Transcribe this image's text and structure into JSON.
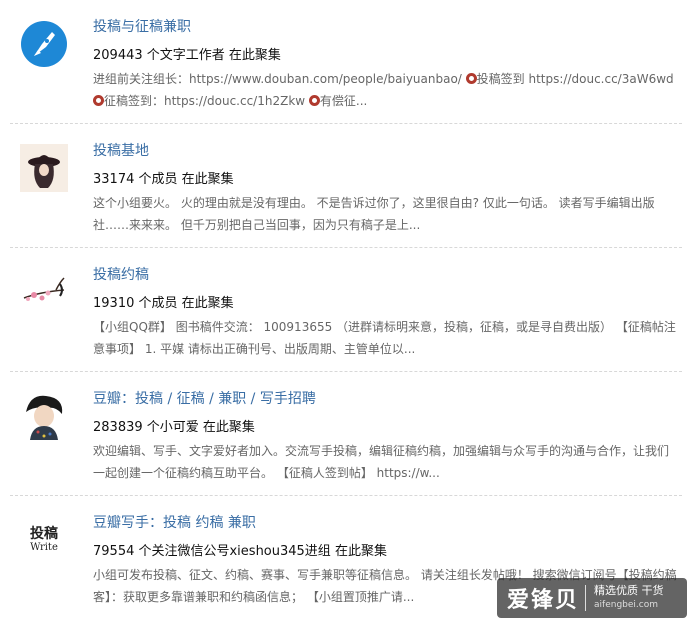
{
  "groups": [
    {
      "title": "投稿与征稿兼职",
      "meta": "209443 个文字工作者 在此聚集",
      "desc_line1_a": "进组前关注组长：https://www.douban.com/people/baiyuanbao/ ",
      "desc_line1_b": "投稿签到 https://douc.cc/3aW6wd",
      "desc_line2_a": "征稿签到：https://douc.cc/1h2Zkw ",
      "desc_line2_b": "有偿征..."
    },
    {
      "title": "投稿基地",
      "meta": "33174 个成员 在此聚集",
      "desc": "这个小组要火。 火的理由就是没有理由。 不是告诉过你了，这里很自由? 仅此一句话。 读者写手编辑出版社……来来来。 但千万别把自己当回事，因为只有稿子是上..."
    },
    {
      "title": "投稿约稿",
      "meta": "19310 个成员 在此聚集",
      "desc": "【小组QQ群】 图书稿件交流： 100913655 （进群请标明来意，投稿，征稿，或是寻自费出版） 【征稿帖注意事项】 1. 平媒 请标出正确刊号、出版周期、主管单位以..."
    },
    {
      "title": "豆瓣：投稿 / 征稿 / 兼职 / 写手招聘",
      "meta": "283839 个小可爱 在此聚集",
      "desc": "欢迎编辑、写手、文字爱好者加入。交流写手投稿，编辑征稿约稿，加强编辑与众写手的沟通与合作，让我们一起创建一个征稿约稿互助平台。 【征稿人签到帖】 https://w..."
    },
    {
      "title": "豆瓣写手：投稿 约稿 兼职",
      "meta": "79554 个关注微信公号xieshou345进组 在此聚集",
      "desc": "小组可发布投稿、征文、约稿、赛事、写手兼职等征稿信息。 请关注组长发帖哦！ 搜索微信订阅号【投稿约稿客】：获取更多靠谱兼职和约稿函信息； 【小组置顶推广请..."
    }
  ],
  "avatar5_text": {
    "line1": "投稿",
    "line2": "Write"
  },
  "watermark": {
    "main": "爱锋贝",
    "tag": "精选优质",
    "tag2": "干货",
    "url": "aifengbei.com"
  },
  "colors": {
    "link": "#3a6ea5",
    "dot": "#b03a2e"
  }
}
